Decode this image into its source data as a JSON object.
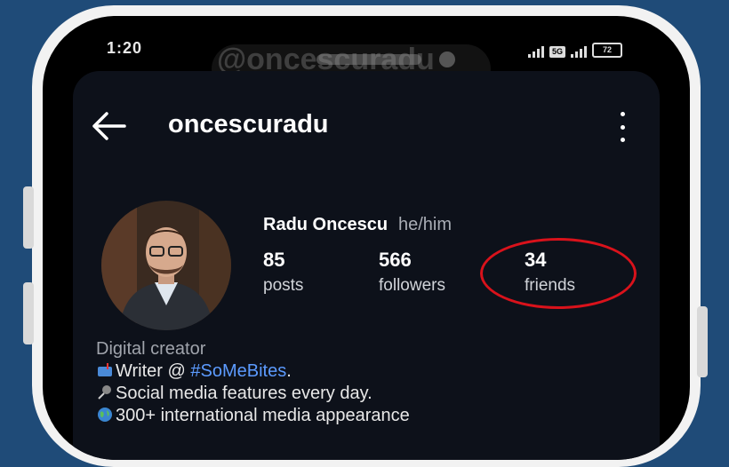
{
  "status_bar": {
    "time": "1:20",
    "network_badge": "5G",
    "battery_level": "72"
  },
  "watermark": "@oncescuradu",
  "header": {
    "username": "oncescuradu",
    "back_icon": "arrow-left-icon",
    "menu_icon": "more-vertical-icon"
  },
  "profile": {
    "display_name": "Radu Oncescu",
    "pronouns": "he/him",
    "stats": [
      {
        "value": "85",
        "label": "posts"
      },
      {
        "value": "566",
        "label": "followers"
      },
      {
        "value": "34",
        "label": "friends"
      }
    ],
    "highlight_color": "#d9121b"
  },
  "bio": {
    "category": "Digital creator",
    "line1_prefix": "Writer @ ",
    "line1_tag": "#SoMeBites",
    "line1_suffix": ".",
    "line2": "Social media features every day.",
    "line3": "300+ international media appearance"
  },
  "colors": {
    "background": "#1f4b78",
    "panel": "#0d111a",
    "link": "#5c9bff"
  }
}
